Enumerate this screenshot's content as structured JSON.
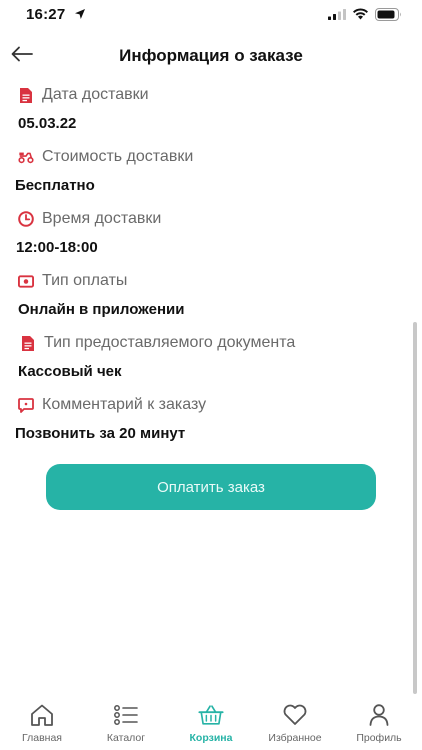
{
  "status_bar": {
    "time": "16:27"
  },
  "header": {
    "title": "Информация о заказе"
  },
  "fields": [
    {
      "label": "Дата доставки",
      "value": "05.03.22"
    },
    {
      "label": "Стоимость доставки",
      "value": "Бесплатно"
    },
    {
      "label": "Время доставки",
      "value": "12:00-18:00"
    },
    {
      "label": "Тип оплаты",
      "value": "Онлайн в приложении"
    },
    {
      "label": "Тип предоставляемого документа",
      "value": "Кассовый чек"
    },
    {
      "label": "Комментарий к заказу",
      "value": "Позвонить за 20 минут"
    }
  ],
  "pay_button": {
    "label": "Оплатить заказ"
  },
  "tabbar": {
    "items": [
      {
        "label": "Главная",
        "icon": "home-icon",
        "active": false
      },
      {
        "label": "Каталог",
        "icon": "list-icon",
        "active": false
      },
      {
        "label": "Корзина",
        "icon": "basket-icon",
        "active": true
      },
      {
        "label": "Избранное",
        "icon": "heart-icon",
        "active": false
      },
      {
        "label": "Профиль",
        "icon": "profile-icon",
        "active": false
      }
    ]
  },
  "colors": {
    "accent": "#26b3a6",
    "icon_red": "#d93340",
    "label_gray": "#6a6a6a"
  }
}
